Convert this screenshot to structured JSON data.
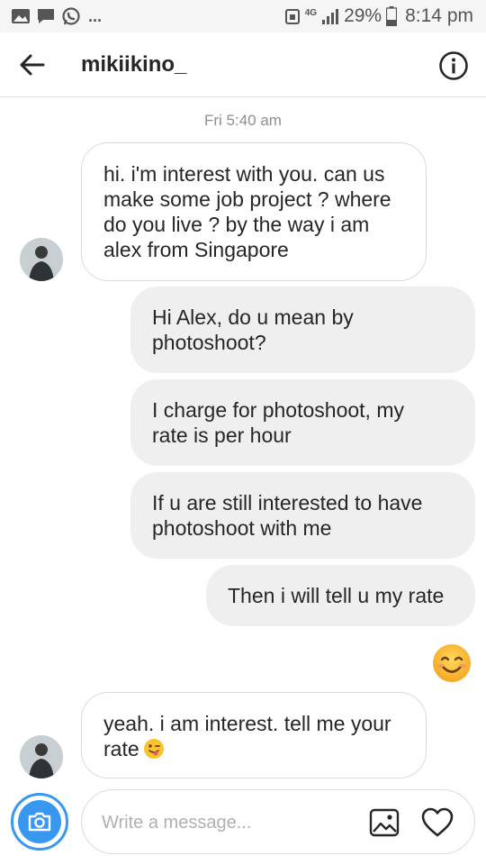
{
  "status_bar": {
    "more": "...",
    "network": "4G",
    "battery": "29%",
    "time": "8:14 pm"
  },
  "header": {
    "username": "mikiikino_"
  },
  "thread": {
    "date_label": "Fri 5:40 am",
    "messages": [
      {
        "from": "them",
        "lines": [
          "hi. i'm interest with you. can us",
          "make some job project ? where",
          "do you live ? by the way i am",
          "alex from Singapore"
        ]
      },
      {
        "from": "me",
        "lines": [
          "Hi Alex, do u mean by",
          "photoshoot?"
        ]
      },
      {
        "from": "me",
        "lines": [
          "I charge for photoshoot, my",
          "rate is per hour"
        ]
      },
      {
        "from": "me",
        "lines": [
          "If u are still interested to have",
          "photoshoot with me"
        ]
      },
      {
        "from": "me",
        "lines": [
          "Then i will tell u my rate"
        ]
      },
      {
        "from": "me",
        "emoji": "smiling-face-icon"
      },
      {
        "from": "them",
        "lines": [
          "yeah. i am interest. tell me your",
          "rate"
        ],
        "emoji": "winking-tongue-face-icon"
      }
    ]
  },
  "composer": {
    "placeholder": "Write a message..."
  },
  "colors": {
    "accent": "#3897f0",
    "outgoing_bubble": "#efefef",
    "border": "#dbdbdb",
    "emoji_yellow": "#f9c32f"
  }
}
